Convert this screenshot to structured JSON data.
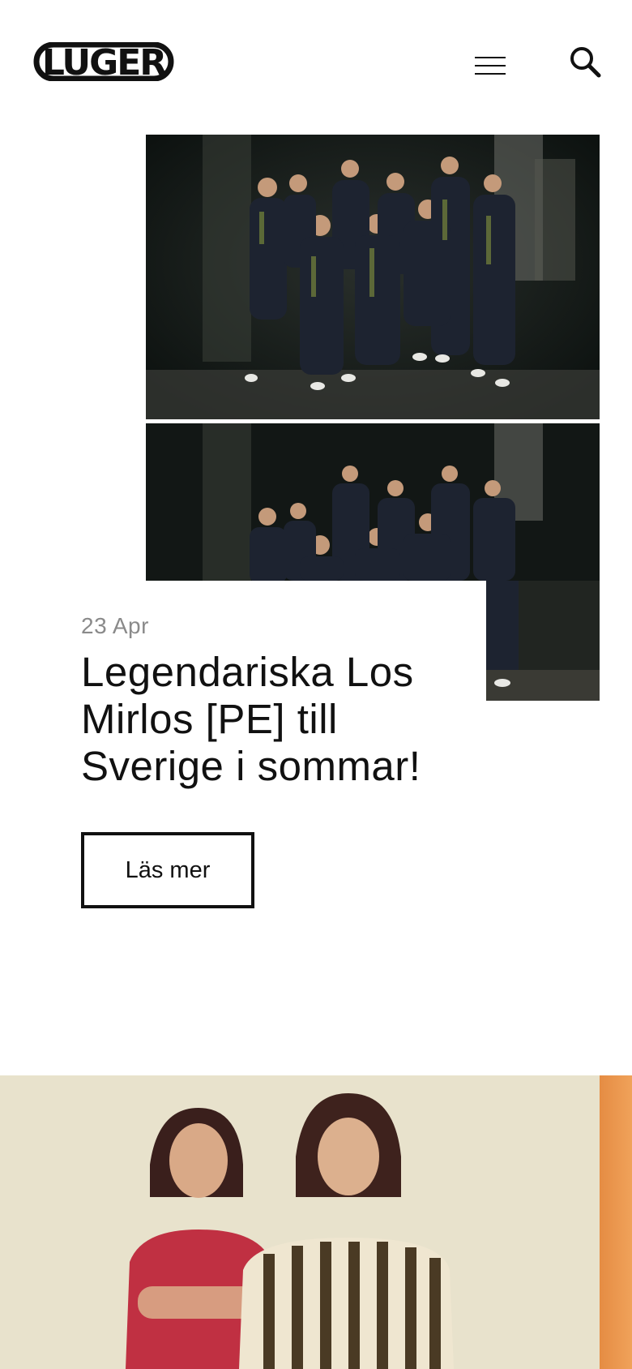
{
  "header": {
    "logo_text": "LUGER",
    "menu_icon": "hamburger-menu-icon",
    "search_icon": "search-icon"
  },
  "featured": {
    "date": "23 Apr",
    "title": "Legendariska Los Mirlos [PE] till Sverige i sommar!",
    "read_more_label": "Läs mer",
    "image_subject": "group-photo-band"
  },
  "next_feature": {
    "image_subject": "duo-photo"
  },
  "colors": {
    "text": "#111111",
    "date": "#8a8a8a",
    "accent_orange": "#e58c43",
    "photo_dark": "#141a17",
    "photo_light": "#e7e1cb"
  }
}
